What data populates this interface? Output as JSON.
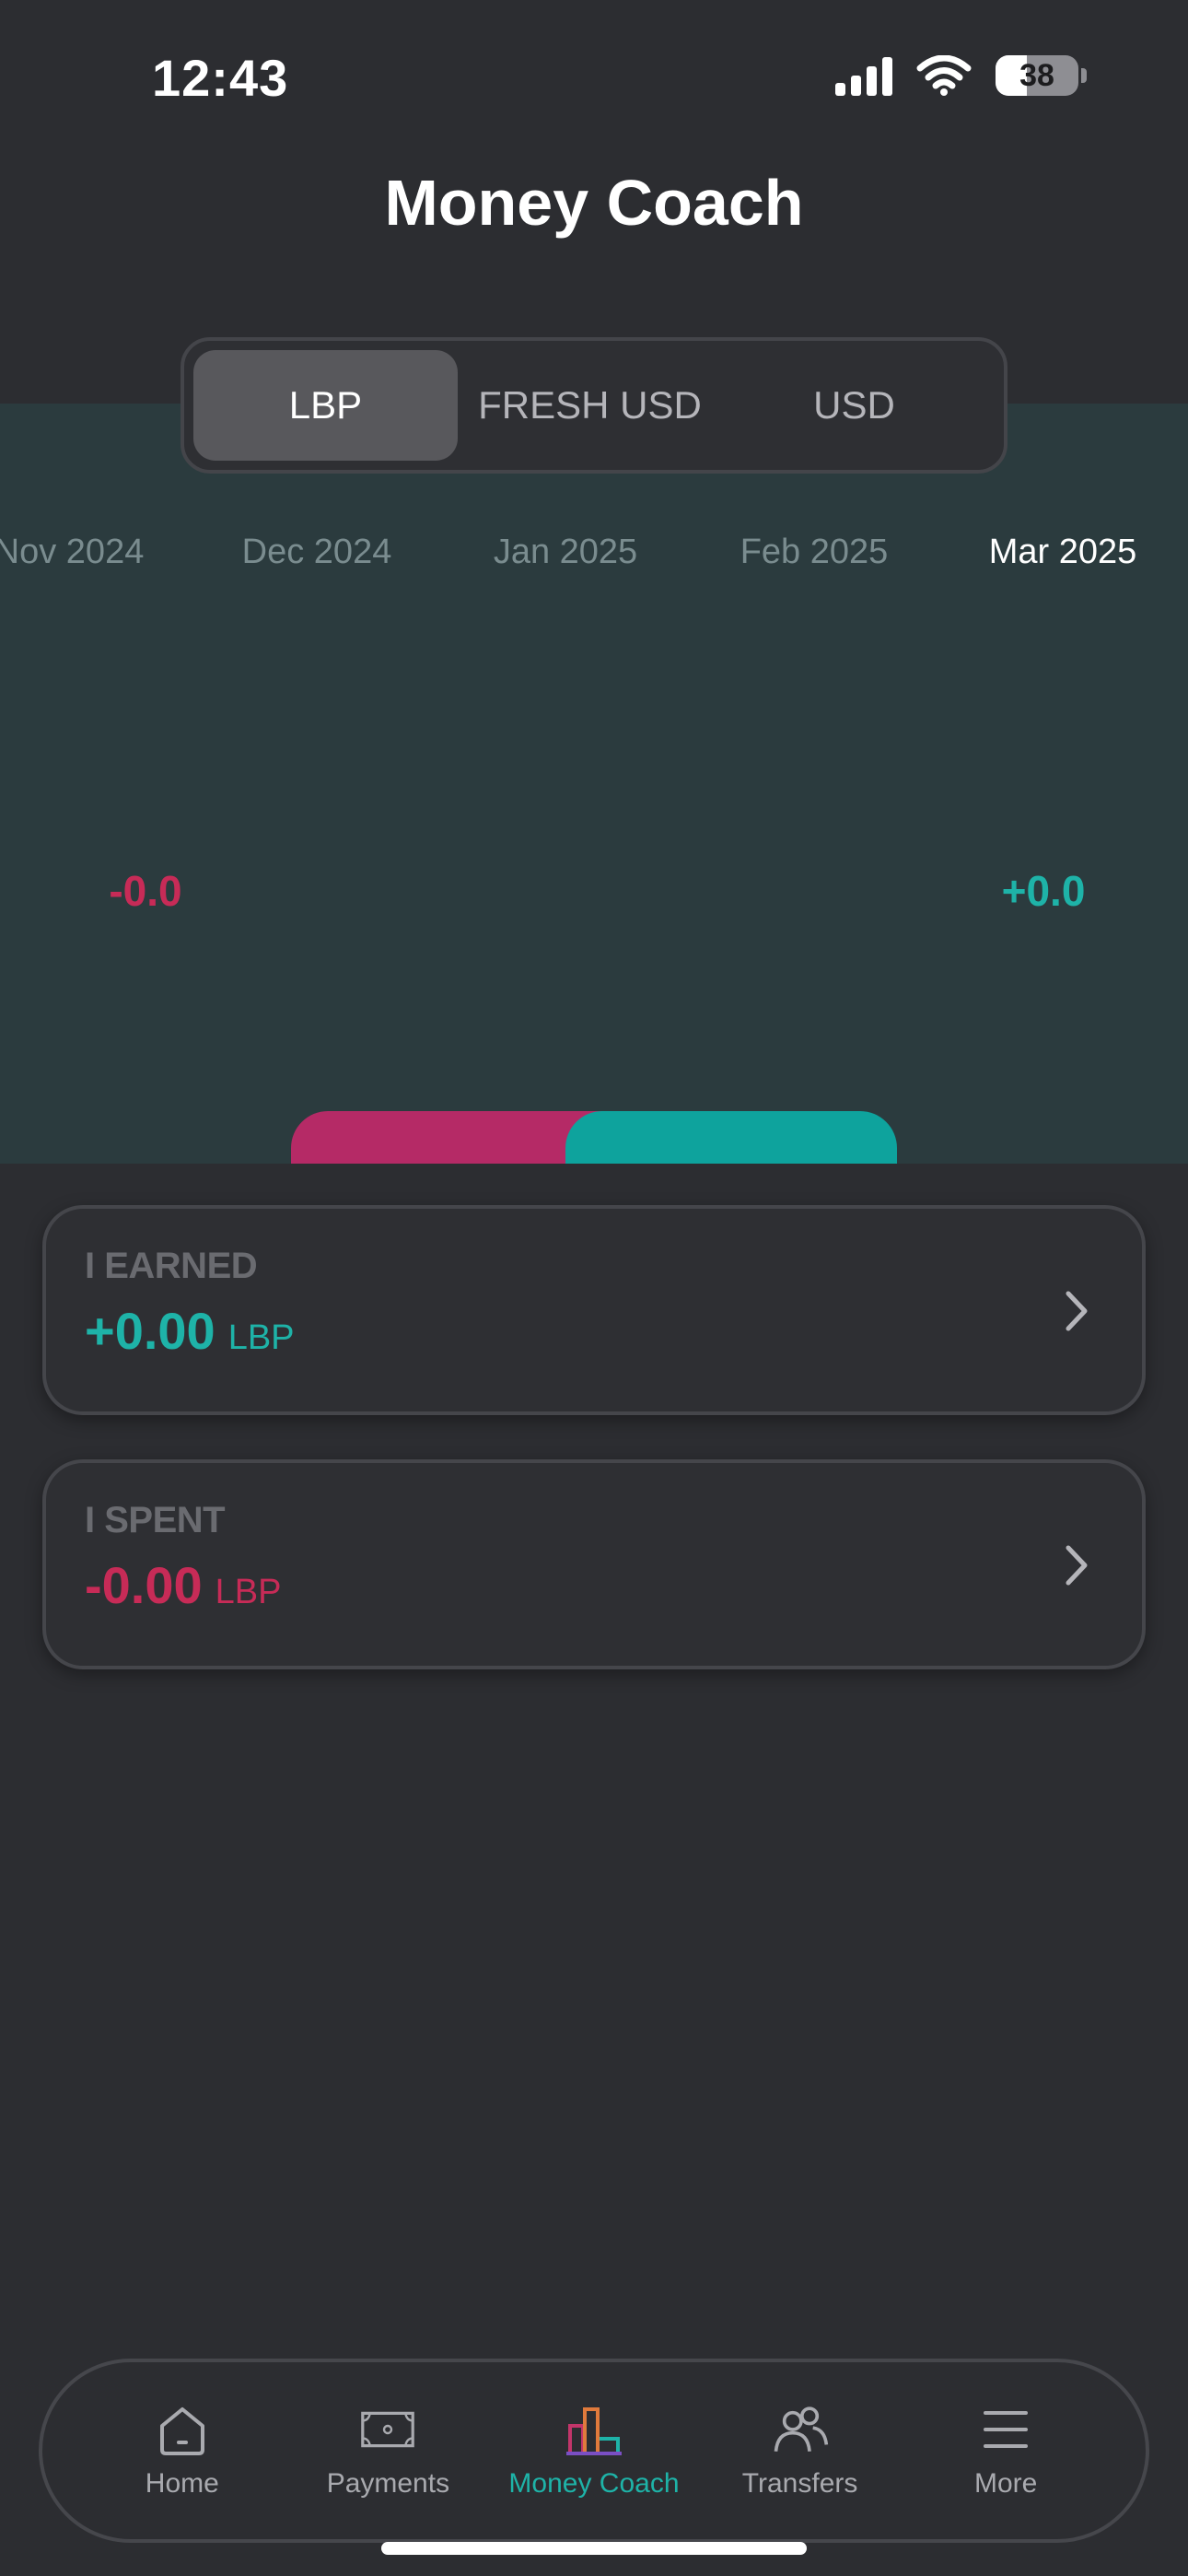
{
  "status_bar": {
    "time": "12:43",
    "battery": "38"
  },
  "header": {
    "title": "Money Coach"
  },
  "currency_tabs": [
    {
      "label": "LBP",
      "active": true
    },
    {
      "label": "FRESH USD",
      "active": false
    },
    {
      "label": "USD",
      "active": false
    }
  ],
  "months": [
    {
      "label": "Nov 2024",
      "active": false
    },
    {
      "label": "Dec 2024",
      "active": false
    },
    {
      "label": "Jan 2025",
      "active": false
    },
    {
      "label": "Feb 2025",
      "active": false
    },
    {
      "label": "Mar 2025",
      "active": true
    }
  ],
  "chart": {
    "spent_value": "-0.0",
    "earned_value": "+0.0",
    "colors": {
      "spent": "#c72b57",
      "earned": "#1eb3a8"
    }
  },
  "cards": {
    "earned": {
      "label": "I EARNED",
      "value": "+0.00",
      "currency": "LBP"
    },
    "spent": {
      "label": "I SPENT",
      "value": "-0.00",
      "currency": "LBP"
    }
  },
  "tab_bar": [
    {
      "label": "Home",
      "icon": "home-icon",
      "active": false
    },
    {
      "label": "Payments",
      "icon": "banknote-icon",
      "active": false
    },
    {
      "label": "Money Coach",
      "icon": "bar-chart-icon",
      "active": true
    },
    {
      "label": "Transfers",
      "icon": "users-icon",
      "active": false
    },
    {
      "label": "More",
      "icon": "menu-icon",
      "active": false
    }
  ],
  "accent_color": "#1eb3a8"
}
